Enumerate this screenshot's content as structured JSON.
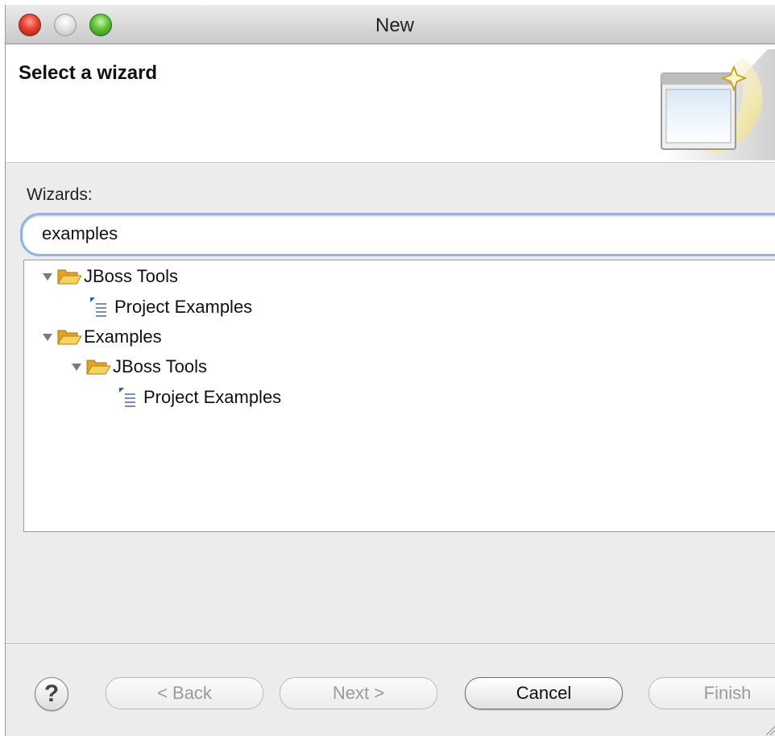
{
  "window": {
    "title": "New"
  },
  "header": {
    "title": "Select a wizard",
    "image_icon": "new-wizard-banner-icon"
  },
  "wizards": {
    "label": "Wizards:",
    "filter_value": "examples",
    "tree": [
      {
        "label": "JBoss Tools",
        "icon": "folder-open-icon",
        "expanded": true,
        "depth": 0
      },
      {
        "label": "Project Examples",
        "icon": "project-examples-icon",
        "depth": 1
      },
      {
        "label": "Examples",
        "icon": "folder-open-icon",
        "expanded": true,
        "depth": 0
      },
      {
        "label": "JBoss Tools",
        "icon": "folder-open-icon",
        "expanded": true,
        "depth": 1
      },
      {
        "label": "Project Examples",
        "icon": "project-examples-icon",
        "depth": 2
      }
    ]
  },
  "buttons": {
    "help_icon": "help-icon",
    "back": "< Back",
    "next": "Next >",
    "cancel": "Cancel",
    "finish": "Finish"
  },
  "colors": {
    "focus_ring": "#8fb5e0",
    "window_bg": "#ececec",
    "close": "#e34234",
    "zoom": "#5fc23a",
    "folder": "#f3c64a"
  }
}
